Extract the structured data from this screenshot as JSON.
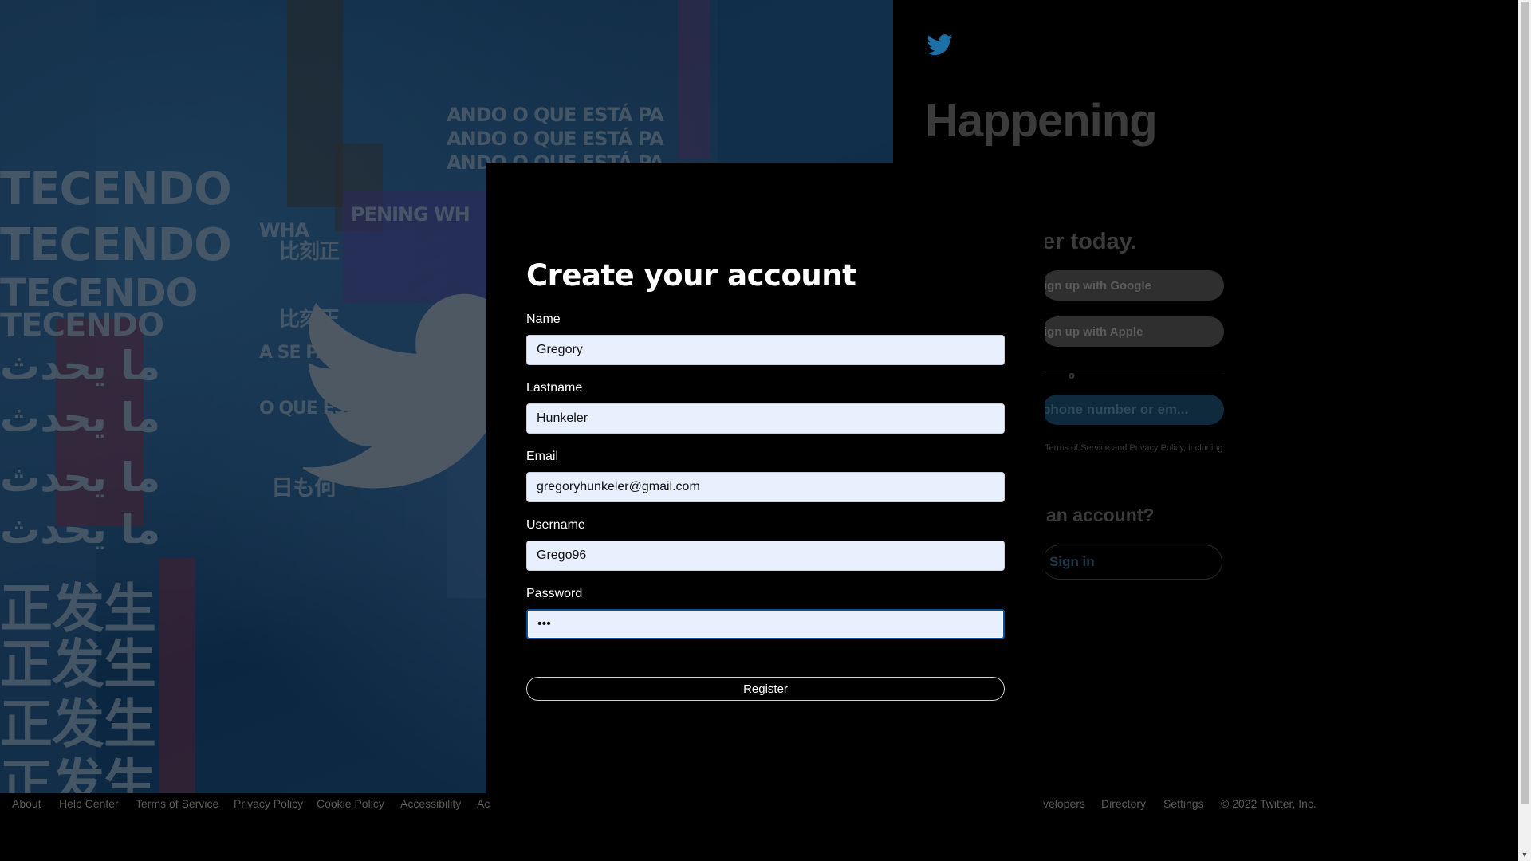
{
  "background": {
    "hero_words": [
      "ANDO O QUE ESTÁ PA",
      "TECENDO",
      "TECENDO",
      "TECENDO",
      "TECENDO",
      "ما يحدث",
      "ما يحدث",
      "ما يحدث",
      "ما يحدث",
      "正发生",
      "正发生",
      "正发生",
      "正发生",
      "比刻正",
      "比刻正",
      "A SE PAS",
      "O QUE ES",
      "日も何",
      "WHA",
      "PENING WH"
    ]
  },
  "right_panel": {
    "title": "Happening",
    "subtitle": "er today.",
    "google_label": "ign up with Google",
    "apple_label": "ign up with Apple",
    "or_label": "o",
    "phone_label": "phone number or em...",
    "terms_text": "Terms of Service and Privacy Policy, including",
    "have_account": "an account?",
    "signin_label": "Sign in"
  },
  "footer": {
    "links": [
      "About",
      "Help Center",
      "Terms of Service",
      "Privacy Policy",
      "Cookie Policy",
      "Accessibility",
      "Ac",
      "velopers",
      "Directory",
      "Settings",
      "© 2022 Twitter, Inc."
    ]
  },
  "modal": {
    "title": "Create your account",
    "name_label": "Name",
    "name_value": "Gregory",
    "lastname_label": "Lastname",
    "lastname_value": "Hunkeler",
    "email_label": "Email",
    "email_value": "gregoryhunkeler@gmail.com",
    "username_label": "Username",
    "username_value": "Grego96",
    "password_label": "Password",
    "password_value": "abc",
    "register_label": "Register"
  },
  "colors": {
    "accent": "#1d9bf0",
    "field_bg": "#e8f0fe",
    "focus_border": "#0b4f9c"
  }
}
